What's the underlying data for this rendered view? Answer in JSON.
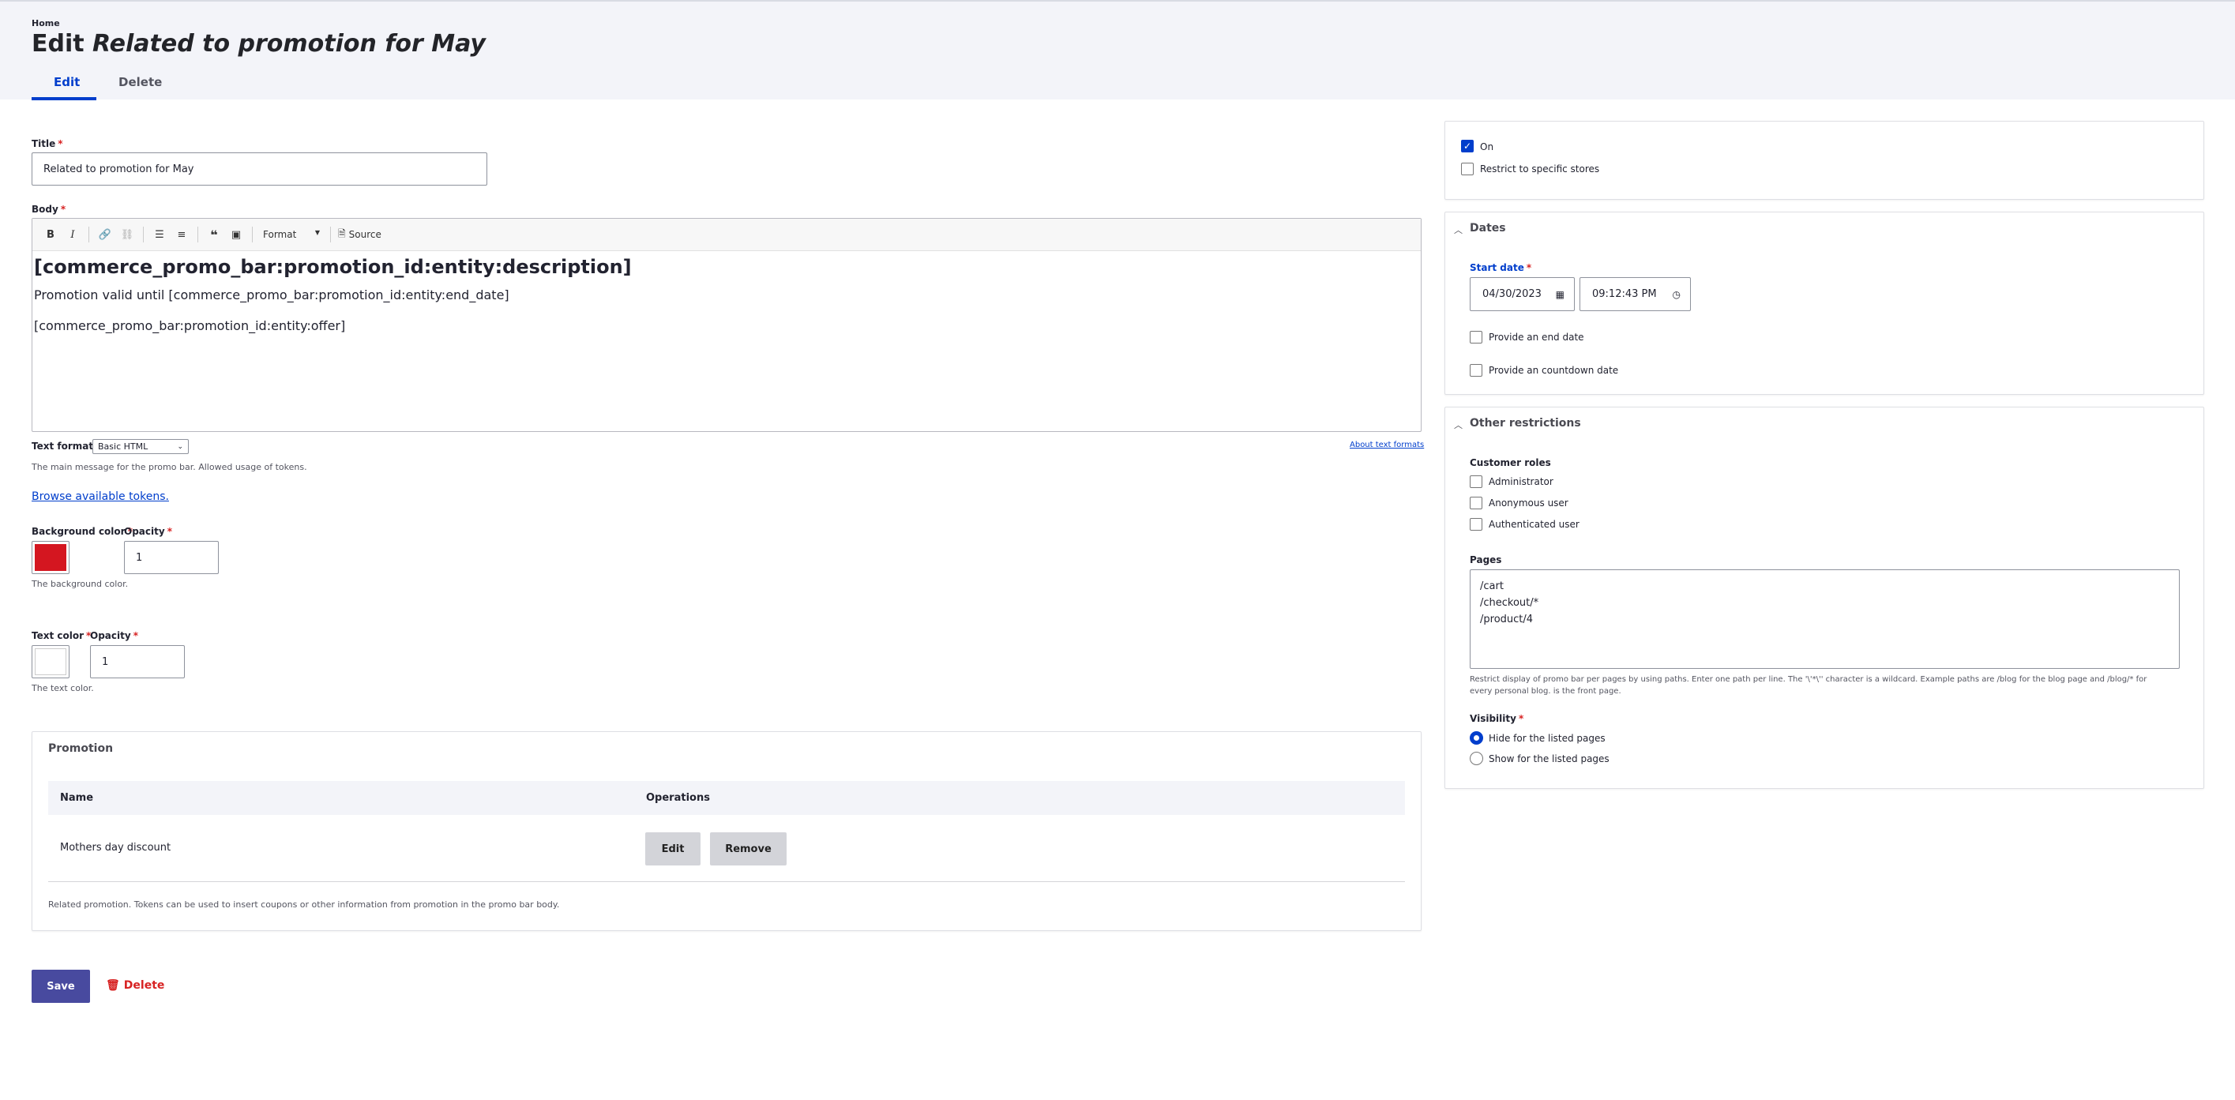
{
  "breadcrumb": "Home",
  "title": {
    "prefix": "Edit",
    "entity": "Related to promotion for May"
  },
  "tabs": [
    "Edit",
    "Delete"
  ],
  "form": {
    "title_label": "Title",
    "title_value": "Related to promotion for May",
    "body_label": "Body",
    "toolbar": {
      "format": "Format",
      "source": "Source"
    },
    "body": {
      "heading": "[commerce_promo_bar:promotion_id:entity:description]",
      "line1": "Promotion valid until [commerce_promo_bar:promotion_id:entity:end_date]",
      "line2": "[commerce_promo_bar:promotion_id:entity:offer]"
    },
    "text_format_label": "Text format",
    "text_format_value": "Basic HTML",
    "about_text_formats": "About text formats",
    "body_description": "The main message for the promo bar. Allowed usage of tokens.",
    "browse_tokens": "Browse available tokens.",
    "bg_color_label": "Background color",
    "bg_color": "#d41620",
    "opacity_label": "Opacity",
    "bg_opacity": "1",
    "bg_description": "The background color.",
    "text_color_label": "Text color",
    "text_color": "#ffffff",
    "text_opacity": "1",
    "text_description": "The text color."
  },
  "promotion": {
    "legend": "Promotion",
    "col_name": "Name",
    "col_operations": "Operations",
    "row_name": "Mothers day discount",
    "edit": "Edit",
    "remove": "Remove",
    "description": "Related promotion. Tokens can be used to insert coupons or other information from promotion in the promo bar body."
  },
  "actions": {
    "save": "Save",
    "delete": "Delete"
  },
  "sidebar": {
    "on": "On",
    "restrict_stores": "Restrict to specific stores",
    "dates_title": "Dates",
    "start_date_label": "Start date",
    "start_date": "04/30/2023",
    "start_time": "09:12:43 PM",
    "end_date": "Provide an end date",
    "countdown": "Provide an countdown date",
    "other_title": "Other restrictions",
    "roles_label": "Customer roles",
    "roles": [
      "Administrator",
      "Anonymous user",
      "Authenticated user"
    ],
    "pages_label": "Pages",
    "pages": [
      "/cart",
      "/checkout/*",
      "/product/4"
    ],
    "pages_description": "Restrict display of promo bar per pages by using paths. Enter one path per line. The '\\'*\\'' character is a wildcard. Example paths are /blog for the blog page and /blog/* for every personal blog. is the front page.",
    "visibility_label": "Visibility",
    "visibility_options": [
      "Hide for the listed pages",
      "Show for the listed pages"
    ]
  }
}
